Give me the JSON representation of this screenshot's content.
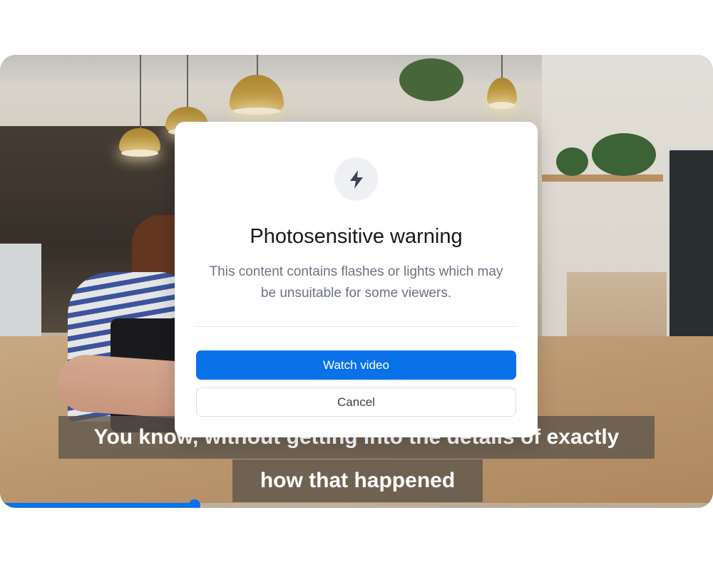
{
  "video": {
    "captions": [
      "You know, without getting into the details of exactly",
      "how that happened"
    ],
    "progress_fraction": 0.273,
    "accent_color": "#0a72e8"
  },
  "modal": {
    "icon": "lightning-icon",
    "title": "Photosensitive warning",
    "message": "This content contains flashes or lights which may be unsuitable for some viewers.",
    "primary_button": "Watch video",
    "secondary_button": "Cancel"
  }
}
